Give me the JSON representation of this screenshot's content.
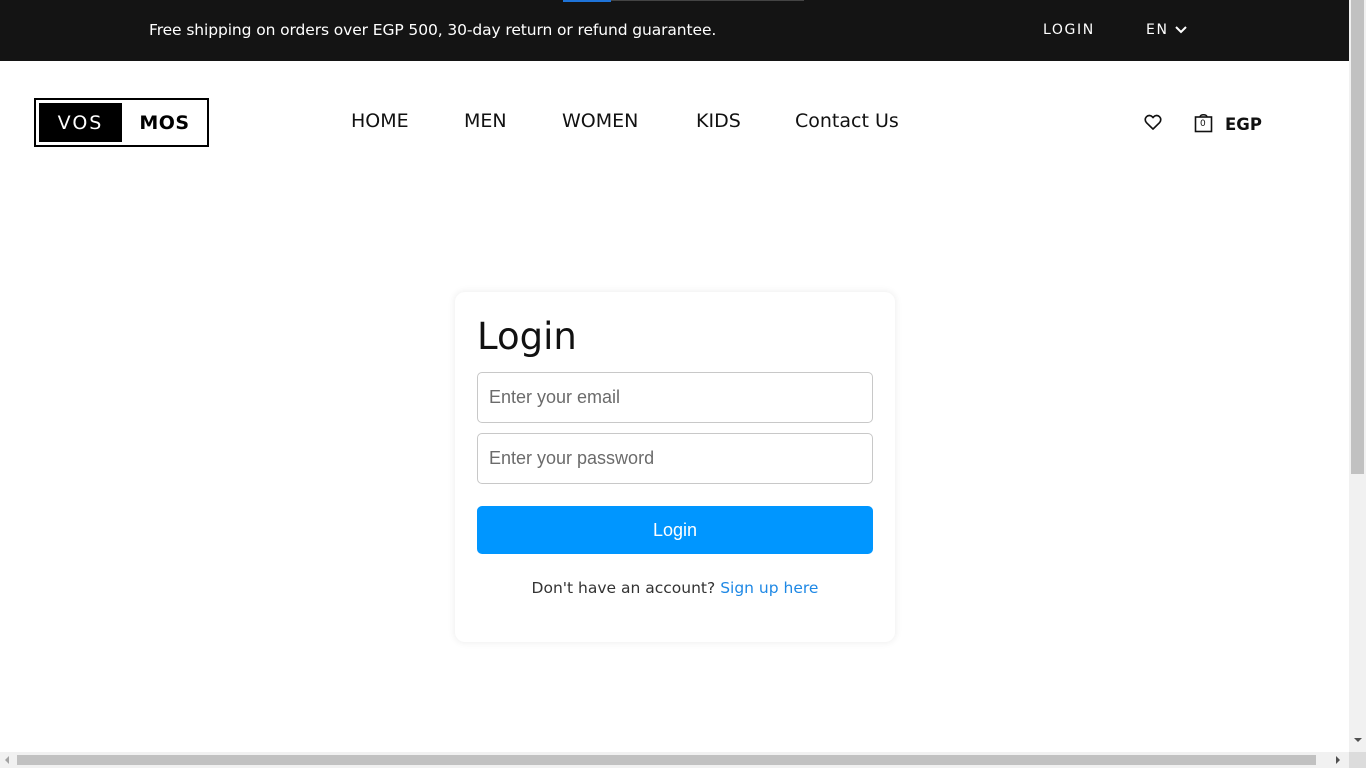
{
  "topbar": {
    "promo_text": "Free shipping on orders over EGP 500, 30-day return or refund guarantee.",
    "login_label": "LOGIN",
    "language": "EN"
  },
  "header": {
    "logo_left": "VOS",
    "logo_right": "MOS",
    "nav": [
      "HOME",
      "MEN",
      "WOMEN",
      "KIDS",
      "Contact Us"
    ],
    "cart_count": "0",
    "currency": "EGP"
  },
  "login_form": {
    "title": "Login",
    "email_placeholder": "Enter your email",
    "password_placeholder": "Enter your password",
    "submit_label": "Login",
    "signup_prompt": "Don't have an account?",
    "signup_link": "Sign up here"
  },
  "colors": {
    "topbar_bg": "#141414",
    "primary_button": "#0096ff",
    "link": "#1e88e5"
  },
  "icons": {
    "wishlist": "heart-icon",
    "cart": "shopping-bag-icon",
    "language_dropdown": "chevron-down-icon"
  }
}
